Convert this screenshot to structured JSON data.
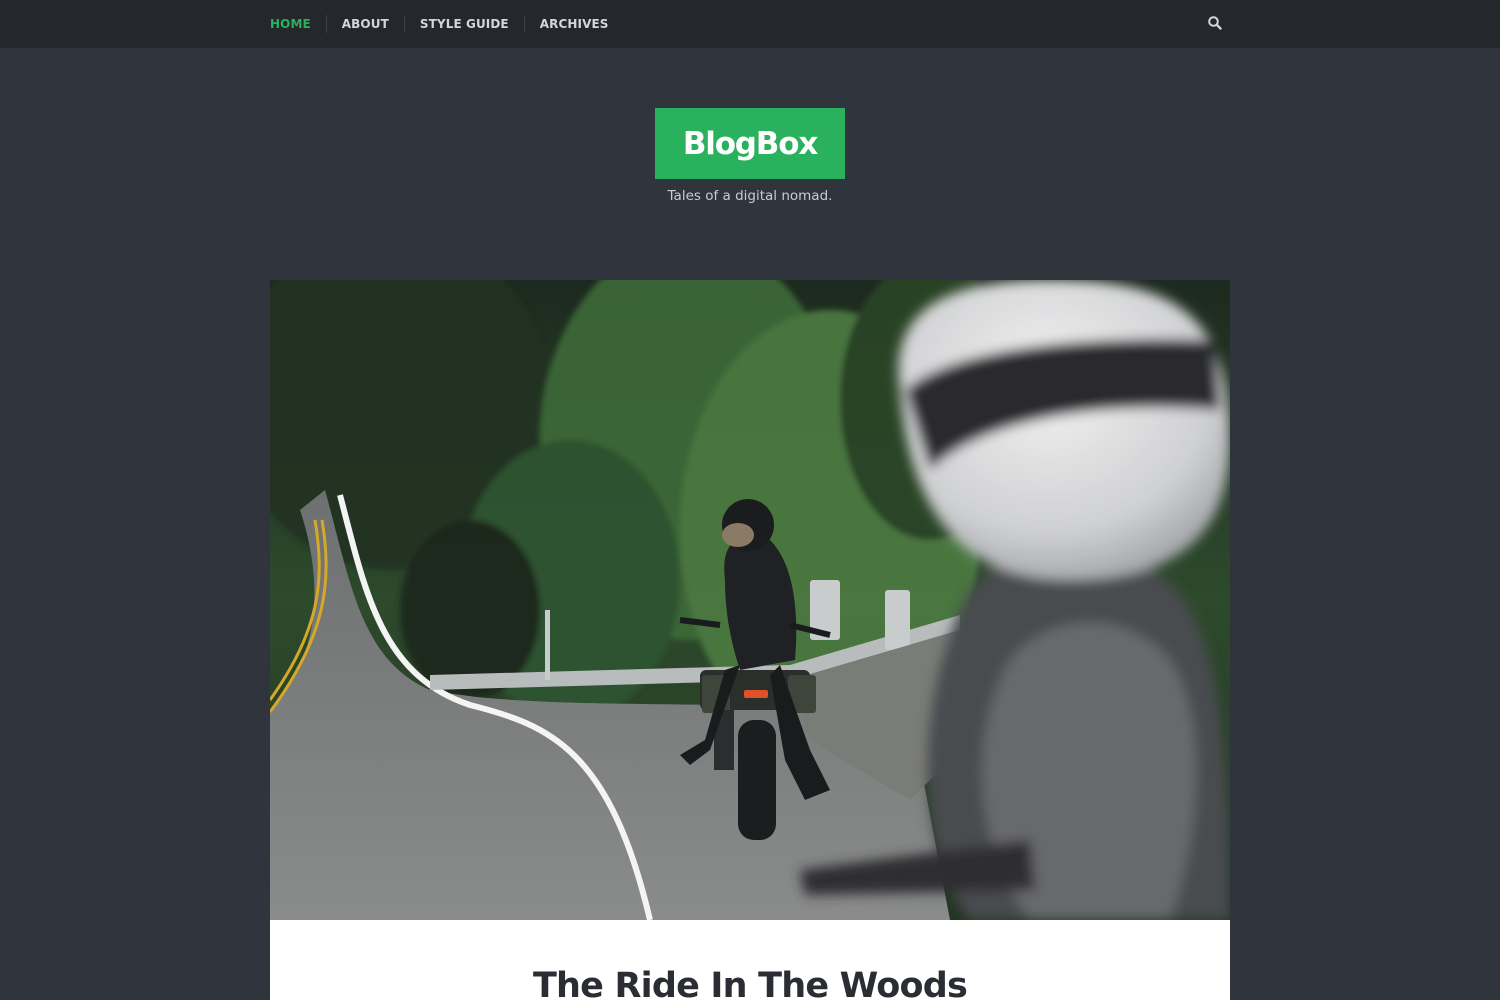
{
  "nav": {
    "items": [
      {
        "label": "HOME",
        "active": true
      },
      {
        "label": "ABOUT",
        "active": false
      },
      {
        "label": "STYLE GUIDE",
        "active": false
      },
      {
        "label": "ARCHIVES",
        "active": false
      }
    ],
    "search_icon": "search-icon"
  },
  "site": {
    "title": "BlogBox",
    "tagline": "Tales of a digital nomad."
  },
  "post": {
    "title": "The Ride In The Woods",
    "image_alt_icon": "photo-motorcyclist-forest-road"
  },
  "colors": {
    "accent": "#2ab15e",
    "topbar": "#24272c",
    "background": "#30353d",
    "nav_text": "#d3d6da",
    "card": "#ffffff",
    "title_text": "#2a2d33"
  }
}
